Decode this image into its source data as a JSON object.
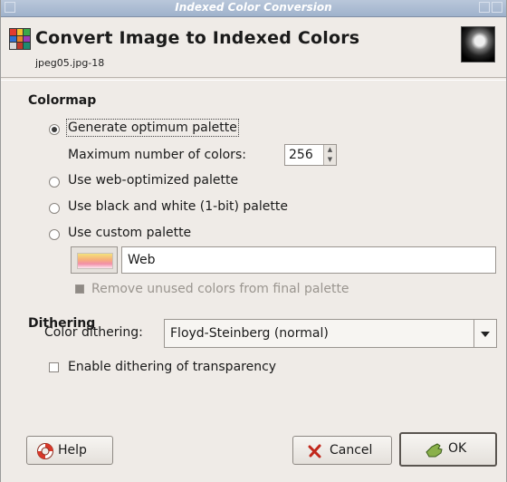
{
  "window": {
    "title": "Indexed Color Conversion"
  },
  "header": {
    "title": "Convert Image to Indexed Colors",
    "subtitle": "jpeg05.jpg-18"
  },
  "colormap": {
    "heading": "Colormap",
    "options": [
      {
        "label": "Generate optimum palette",
        "selected": true
      },
      {
        "label": "Use web-optimized palette",
        "selected": false
      },
      {
        "label": "Use black and white (1-bit) palette",
        "selected": false
      },
      {
        "label": "Use custom palette",
        "selected": false
      }
    ],
    "max_colors_label": "Maximum number of colors:",
    "max_colors_value": "256",
    "custom_palette_name": "Web",
    "remove_unused_label": "Remove unused colors from final palette"
  },
  "dithering": {
    "heading": "Dithering",
    "color_dithering_label": "Color dithering:",
    "color_dithering_value": "Floyd-Steinberg (normal)",
    "enable_transparency_label": "Enable dithering of transparency"
  },
  "buttons": {
    "help": "Help",
    "cancel": "Cancel",
    "ok": "OK"
  },
  "icons": {
    "help": "lifebuoy-icon",
    "cancel": "cross-icon",
    "ok": "thumbs-up-icon"
  }
}
